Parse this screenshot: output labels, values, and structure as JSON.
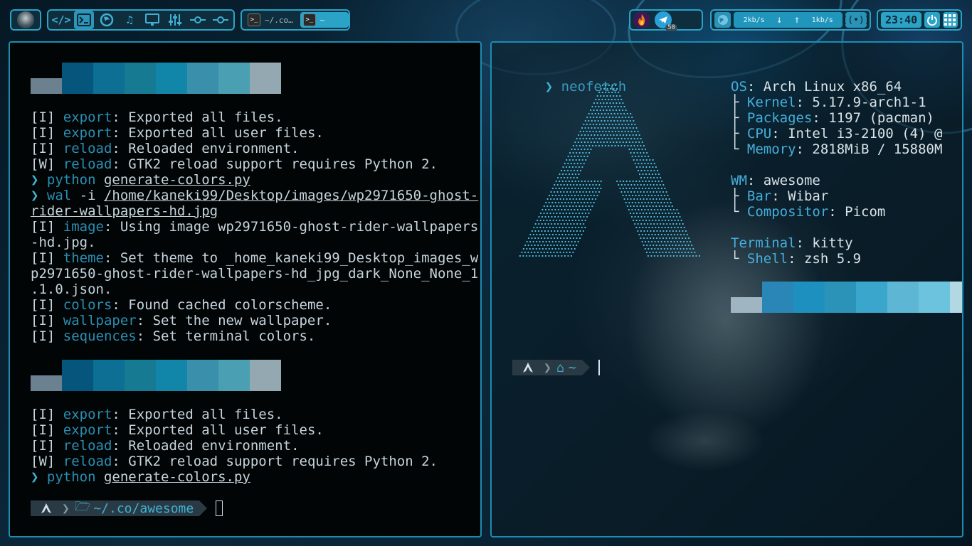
{
  "topbar": {
    "launcher_icons": [
      "code-icon",
      "terminal-icon",
      "firefox-icon",
      "music-icon",
      "display-icon",
      "mixer-icon",
      "node-icon",
      "node-icon"
    ],
    "tasks": [
      {
        "label": "~/.co…",
        "active": false
      },
      {
        "label": "~",
        "active": true
      }
    ],
    "tray_badge": "50",
    "net_down": "2kb/s",
    "net_up": "1kb/s",
    "clock": "23:40"
  },
  "left_terminal": {
    "palette": [
      "#6c8190",
      "#05557d",
      "#0c6f93",
      "#167a93",
      "#1286a8",
      "#3a8fab",
      "#4b9fb2",
      "#94a8b2"
    ],
    "block1": [
      {
        "tag": "[I] ",
        "key": "export",
        "msg": ": Exported all files."
      },
      {
        "tag": "[I] ",
        "key": "export",
        "msg": ": Exported all user files."
      },
      {
        "tag": "[I] ",
        "key": "reload",
        "msg": ": Reloaded environment."
      },
      {
        "tag": "[W] ",
        "key": "reload",
        "msg": ": GTK2 reload support requires Python 2."
      }
    ],
    "cmd1": {
      "prompt": "❯ ",
      "cmd": "python ",
      "arg": "generate-colors.py"
    },
    "cmd2": {
      "prompt": "❯ ",
      "cmd": "wal ",
      "flag": "-i ",
      "arg1": "/home/kaneki99/Desktop/images/wp2971650-ghost-",
      "arg2": "rider-wallpapers-hd.jpg"
    },
    "block2": [
      {
        "tag": "[I] ",
        "key": "image",
        "msg": ": Using image wp2971650-ghost-rider-wallpapers"
      },
      {
        "tag": "",
        "key": "",
        "msg": "-hd.jpg."
      },
      {
        "tag": "[I] ",
        "key": "theme",
        "msg": ": Set theme to _home_kaneki99_Desktop_images_w"
      },
      {
        "tag": "",
        "key": "",
        "msg": "p2971650-ghost-rider-wallpapers-hd_jpg_dark_None_None_1"
      },
      {
        "tag": "",
        "key": "",
        "msg": ".1.0.json."
      },
      {
        "tag": "[I] ",
        "key": "colors",
        "msg": ": Found cached colorscheme."
      },
      {
        "tag": "[I] ",
        "key": "wallpaper",
        "msg": ": Set the new wallpaper."
      },
      {
        "tag": "[I] ",
        "key": "sequences",
        "msg": ": Set terminal colors."
      }
    ],
    "block3": [
      {
        "tag": "[I] ",
        "key": "export",
        "msg": ": Exported all files."
      },
      {
        "tag": "[I] ",
        "key": "export",
        "msg": ": Exported all user files."
      },
      {
        "tag": "[I] ",
        "key": "reload",
        "msg": ": Reloaded environment."
      },
      {
        "tag": "[W] ",
        "key": "reload",
        "msg": ": GTK2 reload support requires Python 2."
      }
    ],
    "cmd3": {
      "prompt": "❯ ",
      "cmd": "python ",
      "arg": "generate-colors.py"
    },
    "prompt_path_home": "~/.co/",
    "prompt_path_dir": "awesome"
  },
  "right_terminal": {
    "cmd": {
      "prompt": "❯ ",
      "text": "neofetch"
    },
    "info": [
      {
        "pre": "",
        "key": "OS",
        "val": ": Arch Linux x86_64"
      },
      {
        "pre": "├ ",
        "key": "Kernel",
        "val": ": 5.17.9-arch1-1"
      },
      {
        "pre": "├ ",
        "key": "Packages",
        "val": ": 1197 (pacman)"
      },
      {
        "pre": "├ ",
        "key": "CPU",
        "val": ": Intel i3-2100 (4) @"
      },
      {
        "pre": "└ ",
        "key": "Memory",
        "val": ": 2818MiB / 15880M"
      },
      {
        "pre": "",
        "key": "",
        "val": ""
      },
      {
        "pre": "",
        "key": "WM",
        "val": ": awesome"
      },
      {
        "pre": "├ ",
        "key": "Bar",
        "val": ": Wibar"
      },
      {
        "pre": "└ ",
        "key": "Compositor",
        "val": ": Picom"
      },
      {
        "pre": "",
        "key": "",
        "val": ""
      },
      {
        "pre": "",
        "key": "Terminal",
        "val": ": kitty"
      },
      {
        "pre": "└ ",
        "key": "Shell",
        "val": ": zsh 5.9"
      }
    ],
    "palette": [
      "#9fb6c2",
      "#2b86b8",
      "#1e90c0",
      "#2a93b7",
      "#3aa6cc",
      "#5db7d4",
      "#6cc3de",
      "#b2d8e4"
    ],
    "prompt_path": "~"
  }
}
